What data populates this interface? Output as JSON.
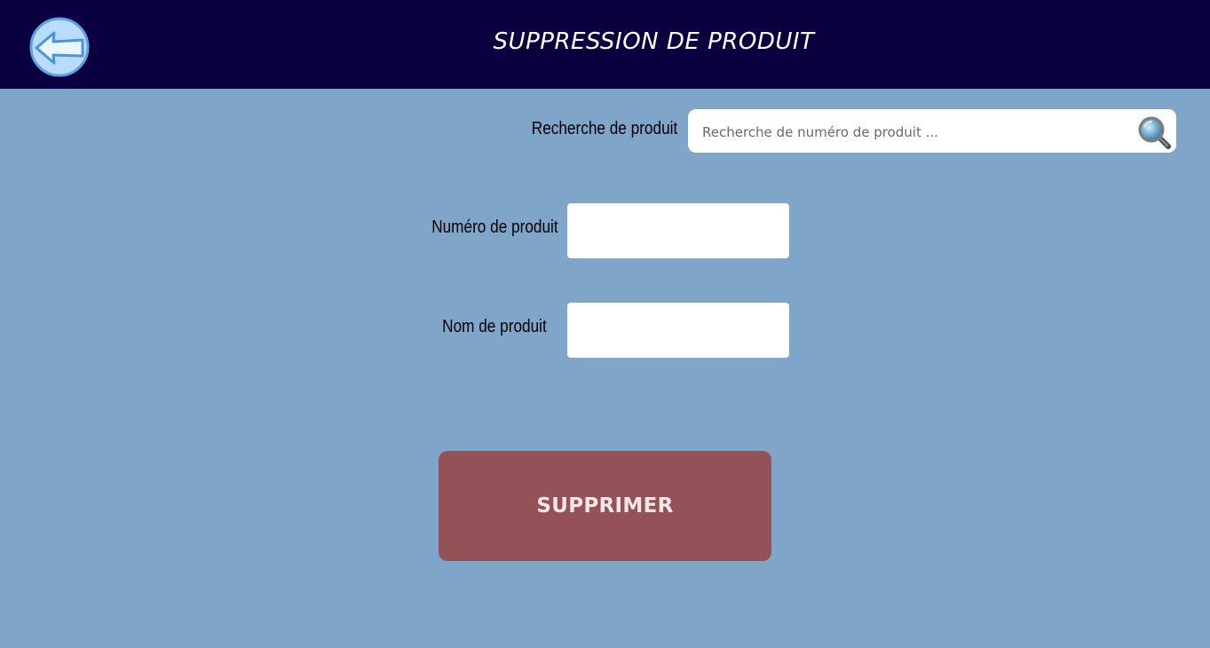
{
  "header": {
    "title": "SUPPRESSION DE PRODUIT",
    "back_icon": "back-arrow-icon"
  },
  "search": {
    "label": "Recherche de produit",
    "placeholder": "Recherche de numéro de produit ...",
    "value": "",
    "icon": "magnifier-icon"
  },
  "form": {
    "product_number_label": "Numéro de produit",
    "product_number_value": "",
    "product_name_label": "Nom de produit",
    "product_name_value": ""
  },
  "actions": {
    "delete_label": "SUPPRIMER"
  },
  "colors": {
    "header_bg": "#0a0040",
    "page_bg": "#7fa5c9",
    "delete_button_bg": "#955158"
  }
}
